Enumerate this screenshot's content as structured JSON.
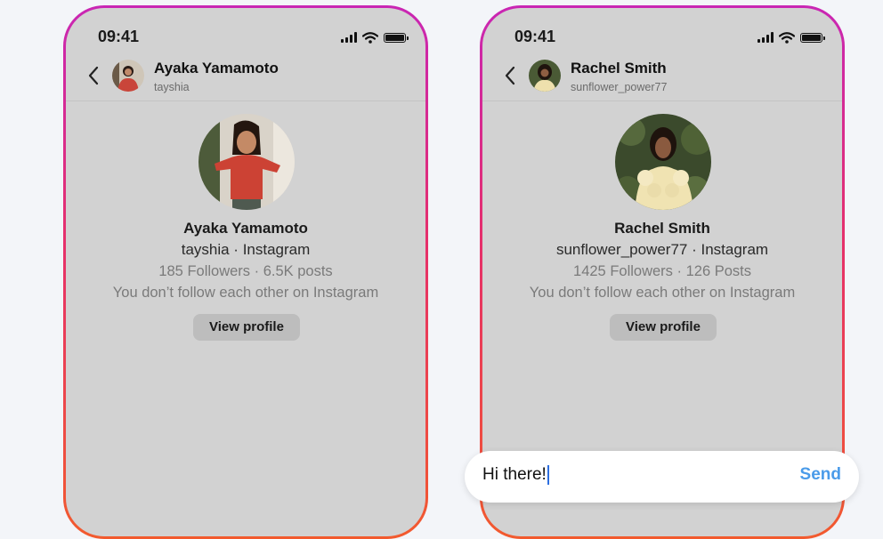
{
  "phones": [
    {
      "status": {
        "time": "09:41"
      },
      "header": {
        "name": "Ayaka Yamamoto",
        "username": "tayshia"
      },
      "profile": {
        "name": "Ayaka Yamamoto",
        "handle_line": "tayshia · Instagram",
        "stats": "185 Followers · 6.5K posts",
        "note": "You don’t follow each other on Instagram",
        "button": "View profile"
      }
    },
    {
      "status": {
        "time": "09:41"
      },
      "header": {
        "name": "Rachel Smith",
        "username": "sunflower_power77"
      },
      "profile": {
        "name": "Rachel Smith",
        "handle_line": "sunflower_power77 · Instagram",
        "stats": "1425 Followers · 126 Posts",
        "note": "You don’t follow each other on Instagram",
        "button": "View profile"
      }
    }
  ],
  "composer": {
    "text": "Hi there!",
    "send_label": "Send"
  },
  "icons": [
    "chevron-left-icon",
    "cellular-signal-icon",
    "wifi-icon",
    "battery-icon"
  ],
  "colors": {
    "frame_gradient_top": "#c926b4",
    "frame_gradient_bottom": "#f25a2e",
    "send": "#4a9be9"
  }
}
